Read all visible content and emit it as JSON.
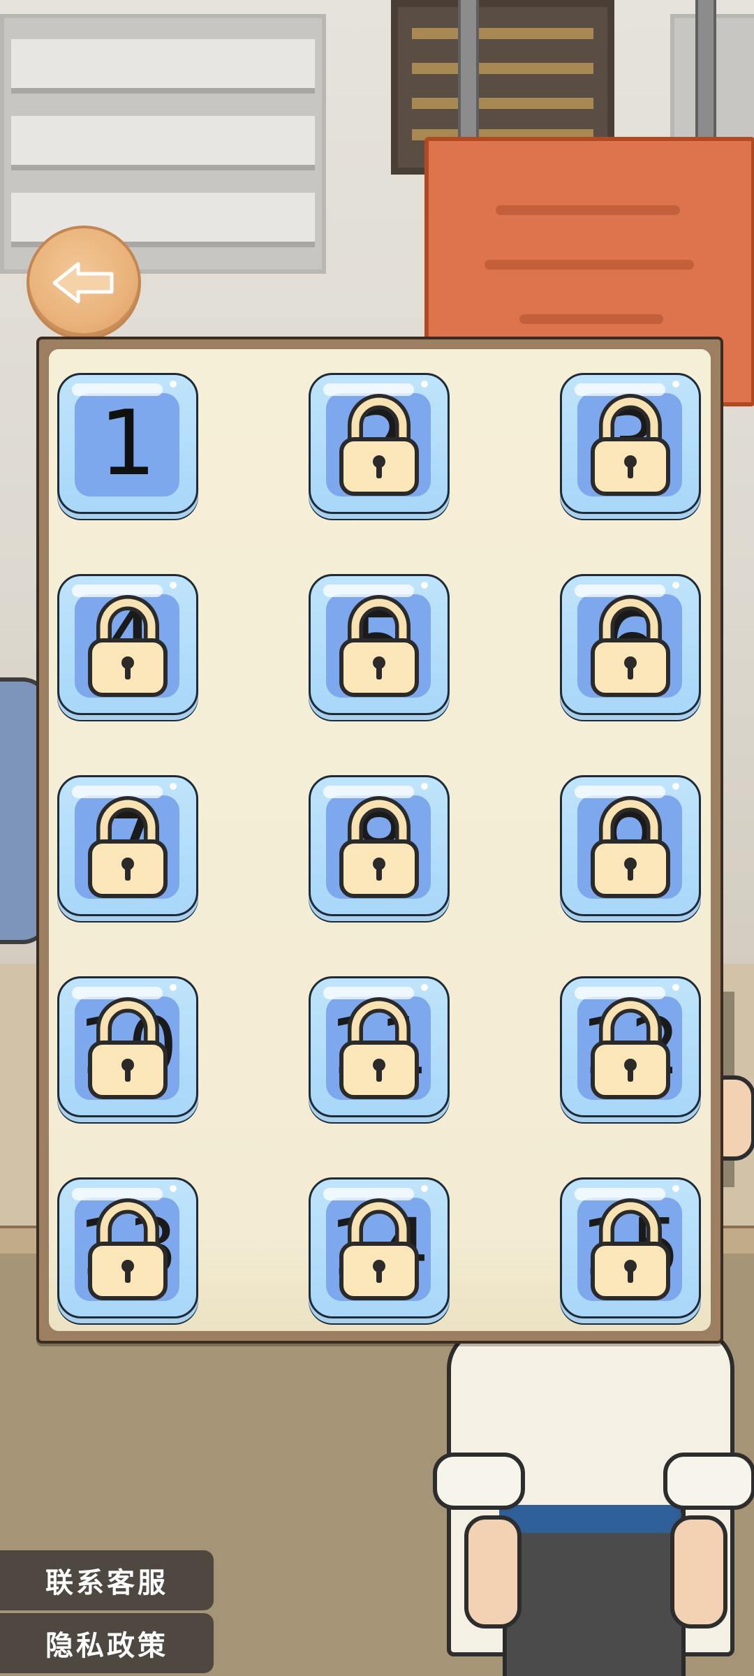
{
  "nav": {
    "back_icon": "back-arrow-icon"
  },
  "levels": [
    {
      "number": "1",
      "locked": false
    },
    {
      "number": "2",
      "locked": true
    },
    {
      "number": "3",
      "locked": true
    },
    {
      "number": "4",
      "locked": true
    },
    {
      "number": "5",
      "locked": true
    },
    {
      "number": "6",
      "locked": true
    },
    {
      "number": "7",
      "locked": true
    },
    {
      "number": "8",
      "locked": true
    },
    {
      "number": "9",
      "locked": true
    },
    {
      "number": "10",
      "locked": true
    },
    {
      "number": "11",
      "locked": true
    },
    {
      "number": "12",
      "locked": true
    },
    {
      "number": "13",
      "locked": true
    },
    {
      "number": "14",
      "locked": true
    },
    {
      "number": "15",
      "locked": true
    }
  ],
  "footer": {
    "contact_label": "联系客服",
    "privacy_label": "隐私政策"
  },
  "colors": {
    "panel_frame": "#9c7e60",
    "panel_fill": "#f6efd8",
    "tile_bg": "#a9d7f8",
    "tile_face": "#7ea8ee",
    "lock_body": "#fae6b8",
    "back_button": "#e9b27a",
    "footer_button": "#4e4841"
  }
}
